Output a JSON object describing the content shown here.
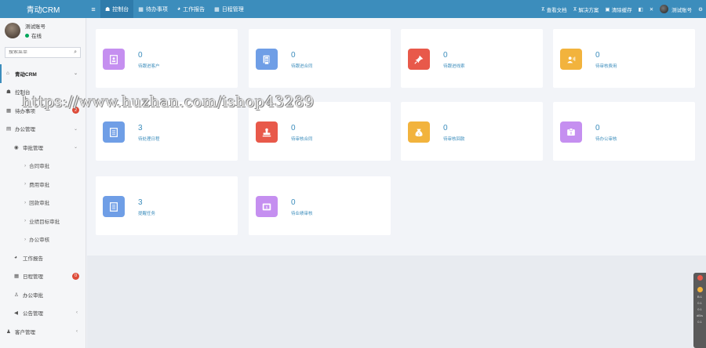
{
  "app": {
    "logo": "青动CRM"
  },
  "topnav": {
    "tabs": [
      {
        "label": "控制台",
        "icon": "dashboard-icon",
        "glyph": "☗",
        "active": true
      },
      {
        "label": "待办事项",
        "icon": "calendar-icon",
        "glyph": "▦",
        "active": false
      },
      {
        "label": "工作报告",
        "icon": "pie-chart-icon",
        "glyph": "◕",
        "active": false
      },
      {
        "label": "日程管理",
        "icon": "calendar-icon",
        "glyph": "▦",
        "active": false
      }
    ],
    "right": [
      {
        "label": "查看文档",
        "icon": "sitemap-icon",
        "glyph": "⊼"
      },
      {
        "label": "解决方案",
        "icon": "sitemap-icon",
        "glyph": "⊼"
      },
      {
        "label": "清除缓存",
        "icon": "trash-icon",
        "glyph": "▣"
      }
    ],
    "username": "测试账号"
  },
  "sidebar": {
    "user": {
      "name": "测试账号",
      "status": "在线"
    },
    "search_placeholder": "搜索菜单",
    "items": [
      {
        "label": "青动CRM",
        "level": 0,
        "icon": "home-icon",
        "glyph": "⌂",
        "arrow": "⌄",
        "type": "header"
      },
      {
        "label": "控制台",
        "level": 0,
        "icon": "dashboard-icon",
        "glyph": "☗"
      },
      {
        "label": "待办事项",
        "level": 0,
        "icon": "calendar-icon",
        "glyph": "▦",
        "badge": "2"
      },
      {
        "label": "办公管理",
        "level": 0,
        "icon": "grid-icon",
        "glyph": "▤",
        "arrow": "⌄"
      },
      {
        "label": "审批管理",
        "level": 1,
        "icon": "eye-icon",
        "glyph": "◉",
        "arrow": "⌄"
      },
      {
        "label": "合同审批",
        "level": 2
      },
      {
        "label": "费用审批",
        "level": 2
      },
      {
        "label": "回款审批",
        "level": 2
      },
      {
        "label": "业绩目标审批",
        "level": 2
      },
      {
        "label": "办公审核",
        "level": 2
      },
      {
        "label": "工作报告",
        "level": 1,
        "icon": "pie-chart-icon",
        "glyph": "◕"
      },
      {
        "label": "日程管理",
        "level": 1,
        "icon": "calendar-icon",
        "glyph": "▦",
        "badge": "0"
      },
      {
        "label": "办公审批",
        "level": 1,
        "icon": "user-icon",
        "glyph": "♙"
      },
      {
        "label": "公告管理",
        "level": 1,
        "icon": "bullhorn-icon",
        "glyph": "◀",
        "arrow": "‹"
      },
      {
        "label": "客户管理",
        "level": 0,
        "icon": "users-icon",
        "glyph": "♟",
        "arrow": "‹"
      }
    ]
  },
  "cards": [
    {
      "value": "0",
      "label": "待跟进客户",
      "color": "#c58ff0",
      "icon": "contact-card-icon"
    },
    {
      "value": "0",
      "label": "待跟进合同",
      "color": "#6f9ee6",
      "icon": "document-icon"
    },
    {
      "value": "0",
      "label": "待跟进线索",
      "color": "#e8594a",
      "icon": "pin-icon"
    },
    {
      "value": "0",
      "label": "待审核费用",
      "color": "#f2b33d",
      "icon": "person-card-icon"
    },
    {
      "value": "3",
      "label": "待处理日程",
      "color": "#6f9ee6",
      "icon": "schedule-icon"
    },
    {
      "value": "0",
      "label": "待审核合同",
      "color": "#e8594a",
      "icon": "stamp-icon"
    },
    {
      "value": "0",
      "label": "待审核回款",
      "color": "#f2b33d",
      "icon": "money-bag-icon"
    },
    {
      "value": "0",
      "label": "待办公审核",
      "color": "#c58ff0",
      "icon": "approval-icon"
    },
    {
      "value": "3",
      "label": "提醒任务",
      "color": "#6f9ee6",
      "icon": "task-list-icon"
    },
    {
      "value": "0",
      "label": "待业绩审核",
      "color": "#c58ff0",
      "icon": "performance-icon"
    }
  ],
  "watermark": "https://www.huzhan.com/ishop43289",
  "side_widget": {
    "lines": [
      "B:1",
      "0.1",
      "0.1",
      "dB/s",
      "0.1"
    ]
  }
}
